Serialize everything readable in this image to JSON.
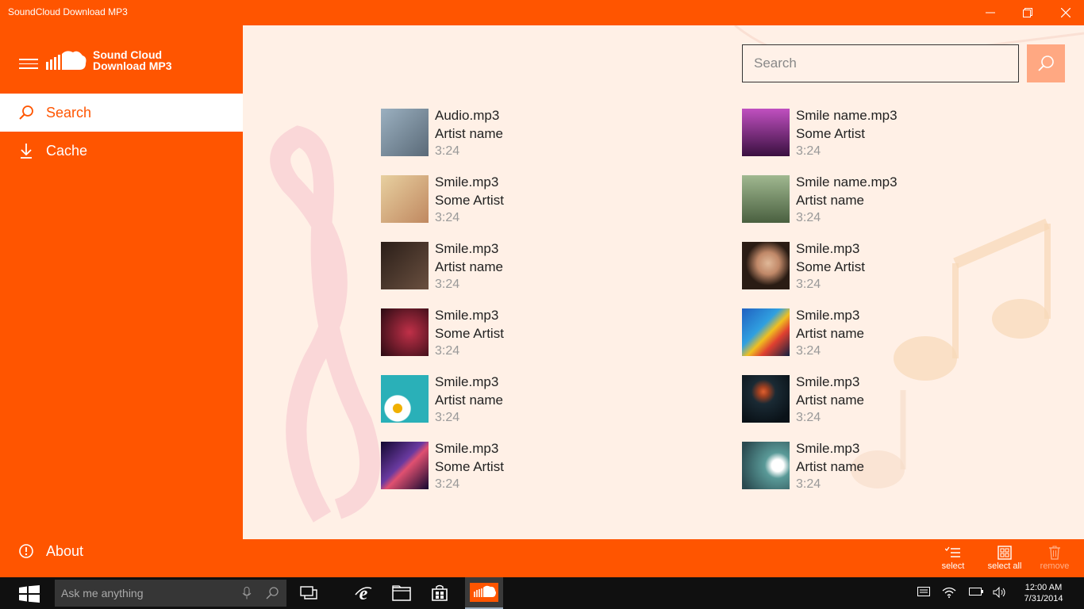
{
  "window": {
    "title": "SoundCloud Download MP3"
  },
  "sidebar": {
    "logo_line1": "Sound Cloud",
    "logo_line2": "Download MP3",
    "items": [
      {
        "label": "Search",
        "icon": "search-icon",
        "active": true
      },
      {
        "label": "Cache",
        "icon": "download-icon",
        "active": false
      }
    ],
    "about_label": "About"
  },
  "search": {
    "placeholder": "Search"
  },
  "tracks_left": [
    {
      "name": "Audio.mp3",
      "artist": "Artist name",
      "duration": "3:24",
      "thumb_color": "#7a8c99"
    },
    {
      "name": "Smile.mp3",
      "artist": "Some Artist",
      "duration": "3:24",
      "thumb_color": "#d8b48a"
    },
    {
      "name": "Smile.mp3",
      "artist": "Artist name",
      "duration": "3:24",
      "thumb_color": "#3a2a20"
    },
    {
      "name": "Smile.mp3",
      "artist": "Some Artist",
      "duration": "3:24",
      "thumb_color": "#3a1018"
    },
    {
      "name": "Smile.mp3",
      "artist": "Artist name",
      "duration": "3:24",
      "thumb_color": "#2aa0a8"
    },
    {
      "name": "Smile.mp3",
      "artist": "Some Artist",
      "duration": "3:24",
      "thumb_color": "#241850"
    }
  ],
  "tracks_right": [
    {
      "name": "Smile name.mp3",
      "artist": "Some Artist",
      "duration": "3:24",
      "thumb_color": "#8a2a7a"
    },
    {
      "name": "Smile name.mp3",
      "artist": "Artist name",
      "duration": "3:24",
      "thumb_color": "#6a8a5a"
    },
    {
      "name": "Smile.mp3",
      "artist": "Some Artist",
      "duration": "3:24",
      "thumb_color": "#4a3a30"
    },
    {
      "name": "Smile.mp3",
      "artist": "Artist name",
      "duration": "3:24",
      "thumb_color": "#2a6aaa"
    },
    {
      "name": "Smile.mp3",
      "artist": "Artist name",
      "duration": "3:24",
      "thumb_color": "#16202a"
    },
    {
      "name": "Smile.mp3",
      "artist": "Artist name",
      "duration": "3:24",
      "thumb_color": "#4a8a8a"
    }
  ],
  "commands": {
    "select": "select",
    "select_all": "select all",
    "remove": "remove"
  },
  "taskbar": {
    "cortana_placeholder": "Ask me anything",
    "time": "12:00 AM",
    "date": "7/31/2014"
  },
  "colors": {
    "accent": "#ff5500",
    "content_bg": "#fff0e6",
    "search_button": "#ffa882"
  }
}
